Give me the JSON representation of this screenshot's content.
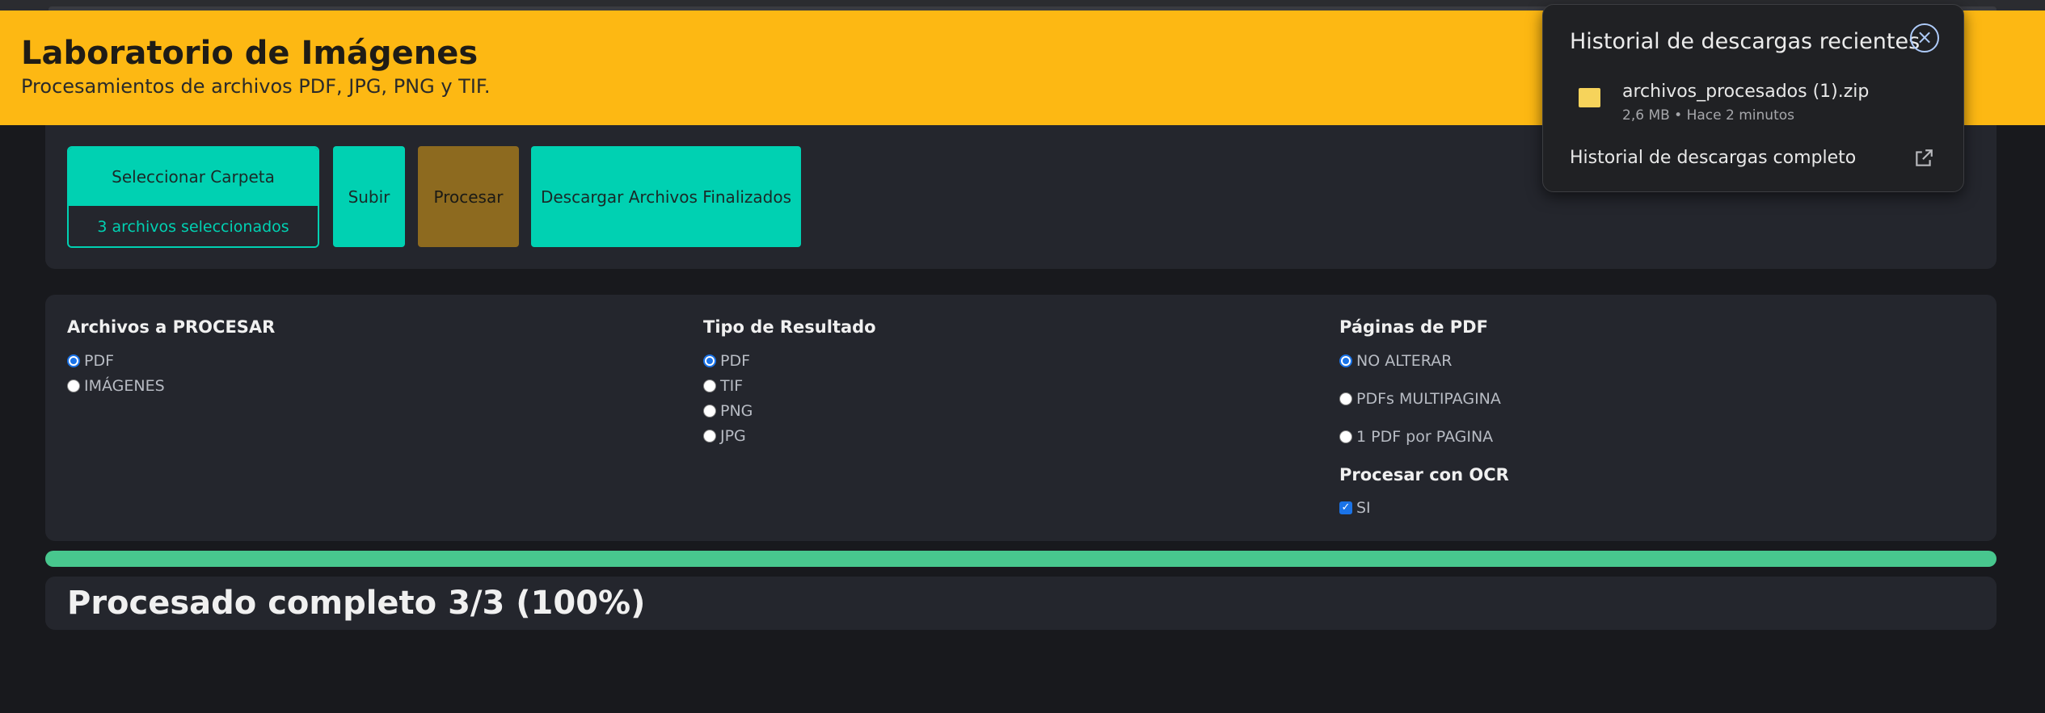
{
  "header": {
    "title": "Laboratorio de Imágenes",
    "subtitle": "Procesamientos de archivos PDF, JPG, PNG y TIF."
  },
  "toolbar": {
    "select_folder_label": "Seleccionar Carpeta",
    "selected_count_text": "3 archivos seleccionados",
    "upload_label": "Subir",
    "process_label": "Procesar",
    "download_label": "Descargar Archivos Finalizados"
  },
  "options": {
    "files_group": {
      "title": "Archivos a PROCESAR",
      "items": [
        {
          "label": "PDF",
          "checked": true
        },
        {
          "label": "IMÁGENES",
          "checked": false
        }
      ]
    },
    "result_group": {
      "title": "Tipo de Resultado",
      "items": [
        {
          "label": "PDF",
          "checked": true
        },
        {
          "label": "TIF",
          "checked": false
        },
        {
          "label": "PNG",
          "checked": false
        },
        {
          "label": "JPG",
          "checked": false
        }
      ]
    },
    "pages_group": {
      "title": "Páginas de PDF",
      "items": [
        {
          "label": "NO ALTERAR",
          "checked": true
        },
        {
          "label": "PDFs MULTIPAGINA",
          "checked": false
        },
        {
          "label": "1 PDF por PAGINA",
          "checked": false
        }
      ]
    },
    "ocr_group": {
      "title": "Procesar con OCR",
      "checkbox": {
        "label": "SI",
        "checked": true
      }
    }
  },
  "progress": {
    "percent": 100,
    "color": "#48c78e"
  },
  "status": {
    "text": "Procesado completo 3/3 (100%)"
  },
  "downloads_popup": {
    "title": "Historial de descargas recientes",
    "file": {
      "name": "archivos_procesados (1).zip",
      "meta": "2,6 MB • Hace 2 minutos"
    },
    "full_history_label": "Historial de descargas completo"
  },
  "colors": {
    "accent_header": "#fdb813",
    "primary_button": "#00d1b2",
    "process_button": "#8d6a1f",
    "background": "#18191d"
  }
}
